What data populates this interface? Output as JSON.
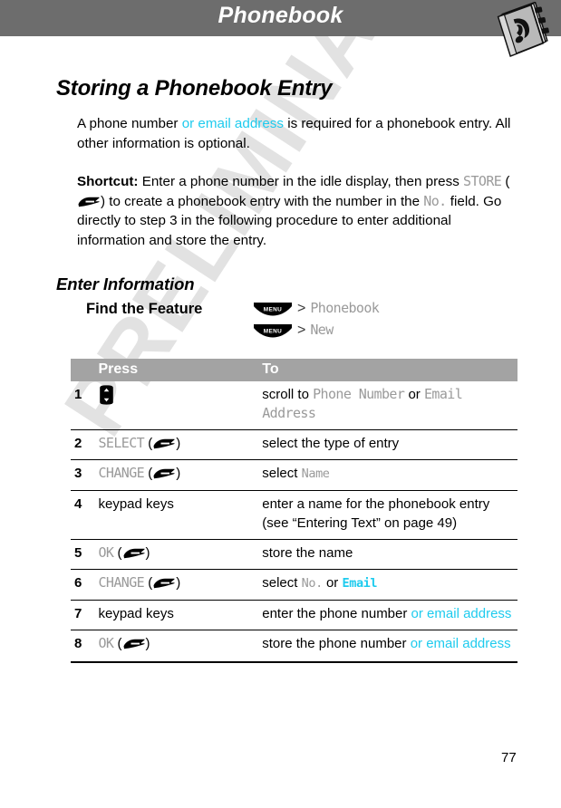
{
  "header": {
    "title": "Phonebook",
    "icon": "phonebook-icon",
    "bar_color": "#6d6d6d"
  },
  "watermark": {
    "text": "PRELIMINARY",
    "color": "#e2e2e2"
  },
  "section": {
    "title": "Storing a Phonebook Entry"
  },
  "paragraphs": {
    "p1_a": "A phone number ",
    "p1_b": "or email address",
    "p1_c": " is required for a phonebook entry. All other information is optional.",
    "p2_label": "Shortcut:",
    "p2_a": " Enter a phone number in the idle display, then press ",
    "p2_store": "STORE",
    "p2_b": ") to create a phonebook entry with the number in the ",
    "p2_no": "No.",
    "p2_c": " field. Go directly to step 3 in the following procedure to enter additional information and store the entry."
  },
  "subsection": {
    "title": "Enter Information"
  },
  "find_feature": {
    "label": "Find the Feature",
    "menu_key_label": "MENU",
    "separator": ">",
    "steps": [
      {
        "key": "MENU",
        "target": "Phonebook"
      },
      {
        "key": "MENU",
        "target": "New"
      }
    ]
  },
  "table": {
    "columns": [
      "",
      "Press",
      "To"
    ],
    "rows": [
      {
        "num": "1",
        "press_kind": "navkey",
        "press_text": "",
        "to_parts": [
          {
            "t": "scroll to ",
            "s": "plain"
          },
          {
            "t": "Phone Number",
            "s": "lcd-big"
          },
          {
            "t": " or ",
            "s": "plain"
          },
          {
            "t": "Email Address",
            "s": "lcd-big"
          }
        ]
      },
      {
        "num": "2",
        "press_kind": "softkey",
        "press_text": "SELECT",
        "to_parts": [
          {
            "t": "select the type of entry",
            "s": "plain"
          }
        ]
      },
      {
        "num": "3",
        "press_kind": "softkey",
        "press_text": "CHANGE",
        "to_parts": [
          {
            "t": "select ",
            "s": "plain"
          },
          {
            "t": "Name",
            "s": "lcd"
          }
        ]
      },
      {
        "num": "4",
        "press_kind": "text",
        "press_text": "keypad keys",
        "to_parts": [
          {
            "t": "enter a name for the phonebook entry (see “Entering Text” on page 49)",
            "s": "plain"
          }
        ]
      },
      {
        "num": "5",
        "press_kind": "softkey",
        "press_text": "OK",
        "to_parts": [
          {
            "t": "store the name",
            "s": "plain"
          }
        ]
      },
      {
        "num": "6",
        "press_kind": "softkey",
        "press_text": "CHANGE",
        "to_parts": [
          {
            "t": "select ",
            "s": "plain"
          },
          {
            "t": "No.",
            "s": "lcd"
          },
          {
            "t": " or ",
            "s": "plain"
          },
          {
            "t": "Email",
            "s": "lcd-cy"
          }
        ]
      },
      {
        "num": "7",
        "press_kind": "text",
        "press_text": "keypad keys",
        "to_parts": [
          {
            "t": "enter the phone number ",
            "s": "plain"
          },
          {
            "t": "or email address",
            "s": "cyan"
          }
        ]
      },
      {
        "num": "8",
        "press_kind": "softkey",
        "press_text": "OK",
        "to_parts": [
          {
            "t": "store the phone number ",
            "s": "plain"
          },
          {
            "t": "or email address",
            "s": "cyan"
          }
        ]
      }
    ]
  },
  "footer": {
    "page_number": "77"
  },
  "colors": {
    "cyan": "#1ecbee",
    "lcd_gray": "#9a9a9a",
    "table_header": "#a3a3a3",
    "header_bar": "#6d6d6d"
  }
}
